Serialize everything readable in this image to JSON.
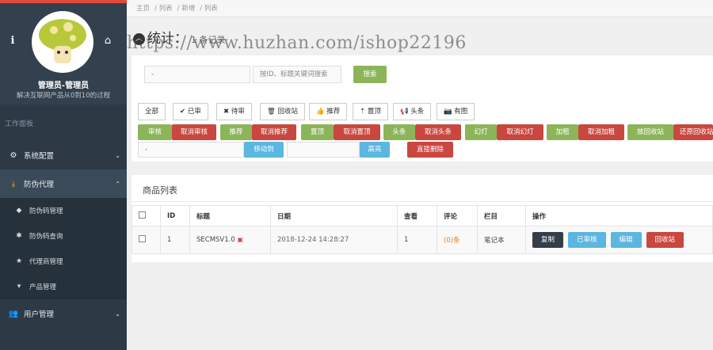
{
  "sidebar": {
    "username": "管理员-管理员",
    "subtitle": "解决互联网产品从0到10的过程",
    "section": "工作面板",
    "menu": [
      {
        "label": "系统配置",
        "icon": "cogs-icon"
      },
      {
        "label": "防伪代理",
        "icon": "download-icon"
      },
      {
        "label": "用户管理",
        "icon": "users-icon"
      }
    ],
    "submenu": [
      {
        "label": "防伪码管理",
        "icon": "tag-icon"
      },
      {
        "label": "防伪码查询",
        "icon": "gear-icon"
      },
      {
        "label": "代理商管理",
        "icon": "star-icon"
      },
      {
        "label": "产品管理",
        "icon": "cart-icon"
      }
    ]
  },
  "breadcrumb": [
    "主页",
    "列表",
    "新增",
    "列表"
  ],
  "page": {
    "title": "统计：",
    "count": "1 条记录",
    "watermark": "https://www.huzhan.com/ishop22196"
  },
  "search": {
    "select_value": "-",
    "placeholder": "按ID、标题关键词搜索",
    "button": "搜索"
  },
  "filters": [
    "全部",
    "已审",
    "待审",
    "回收站",
    "推荐",
    "置顶",
    "头条",
    "有图"
  ],
  "actions": [
    {
      "on": "审核",
      "off": "取消审核"
    },
    {
      "on": "推荐",
      "off": "取消推荐"
    },
    {
      "on": "置顶",
      "off": "取消置顶"
    },
    {
      "on": "头条",
      "off": "取消头条"
    },
    {
      "on": "幻灯",
      "off": "取消幻灯"
    },
    {
      "on": "加粗",
      "off": "取消加粗"
    },
    {
      "on": "放回收站",
      "off": "还原回收站"
    }
  ],
  "move": {
    "select_value": "-",
    "button": "移动到",
    "highlight": "高亮",
    "delete": "直接删除"
  },
  "list": {
    "title": "商品列表",
    "headers": [
      "ID",
      "标题",
      "日期",
      "查看",
      "评论",
      "栏目",
      "操作"
    ],
    "rows": [
      {
        "id": "1",
        "title": "SECMSV1.0",
        "date": "2018-12-24 14:28:27",
        "views": "1",
        "comments": "(0)条",
        "column": "笔记本",
        "ops": [
          "复制",
          "已审核",
          "编辑",
          "回收站"
        ]
      }
    ]
  },
  "colors": {
    "sidebar": "#2d3a46",
    "green": "#8cb55a",
    "red": "#c9473f",
    "blue": "#5bb6e0",
    "dark": "#333e48"
  }
}
